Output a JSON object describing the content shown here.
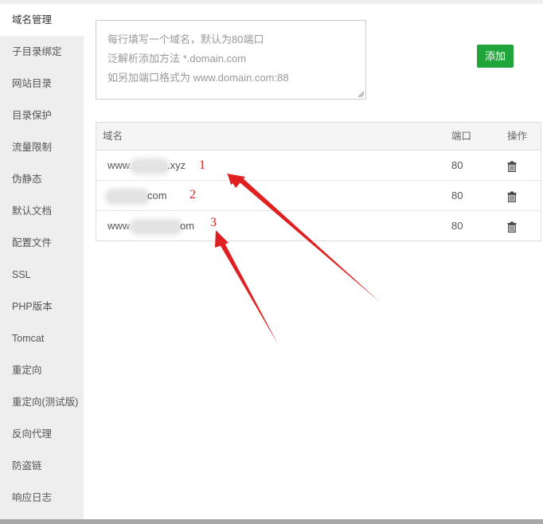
{
  "sidebar": {
    "items": [
      {
        "label": "域名管理",
        "active": true
      },
      {
        "label": "子目录绑定"
      },
      {
        "label": "网站目录"
      },
      {
        "label": "目录保护"
      },
      {
        "label": "流量限制"
      },
      {
        "label": "伪静态"
      },
      {
        "label": "默认文档"
      },
      {
        "label": "配置文件"
      },
      {
        "label": "SSL"
      },
      {
        "label": "PHP版本"
      },
      {
        "label": "Tomcat"
      },
      {
        "label": "重定向"
      },
      {
        "label": "重定向(测试版)"
      },
      {
        "label": "反向代理"
      },
      {
        "label": "防盗链"
      },
      {
        "label": "响应日志"
      }
    ]
  },
  "form": {
    "placeholder_lines": [
      "每行填写一个域名，默认为80端口",
      "泛解析添加方法 *.domain.com",
      "如另加端口格式为 www.domain.com:88"
    ],
    "add_button": "添加"
  },
  "table": {
    "headers": {
      "domain": "域名",
      "port": "端口",
      "action": "操作"
    },
    "rows": [
      {
        "prefix": "www.",
        "suffix": ".xyz",
        "port": "80"
      },
      {
        "prefix": "",
        "suffix": "com",
        "port": "80"
      },
      {
        "prefix": "www.",
        "suffix": "om",
        "port": "80"
      }
    ]
  },
  "annotations": {
    "labels": [
      "1",
      "2",
      "3"
    ],
    "color": "#e02020"
  },
  "colors": {
    "accent_green": "#20a53a",
    "sidebar_bg": "#eeeeee",
    "annotation_red": "#e02020"
  }
}
